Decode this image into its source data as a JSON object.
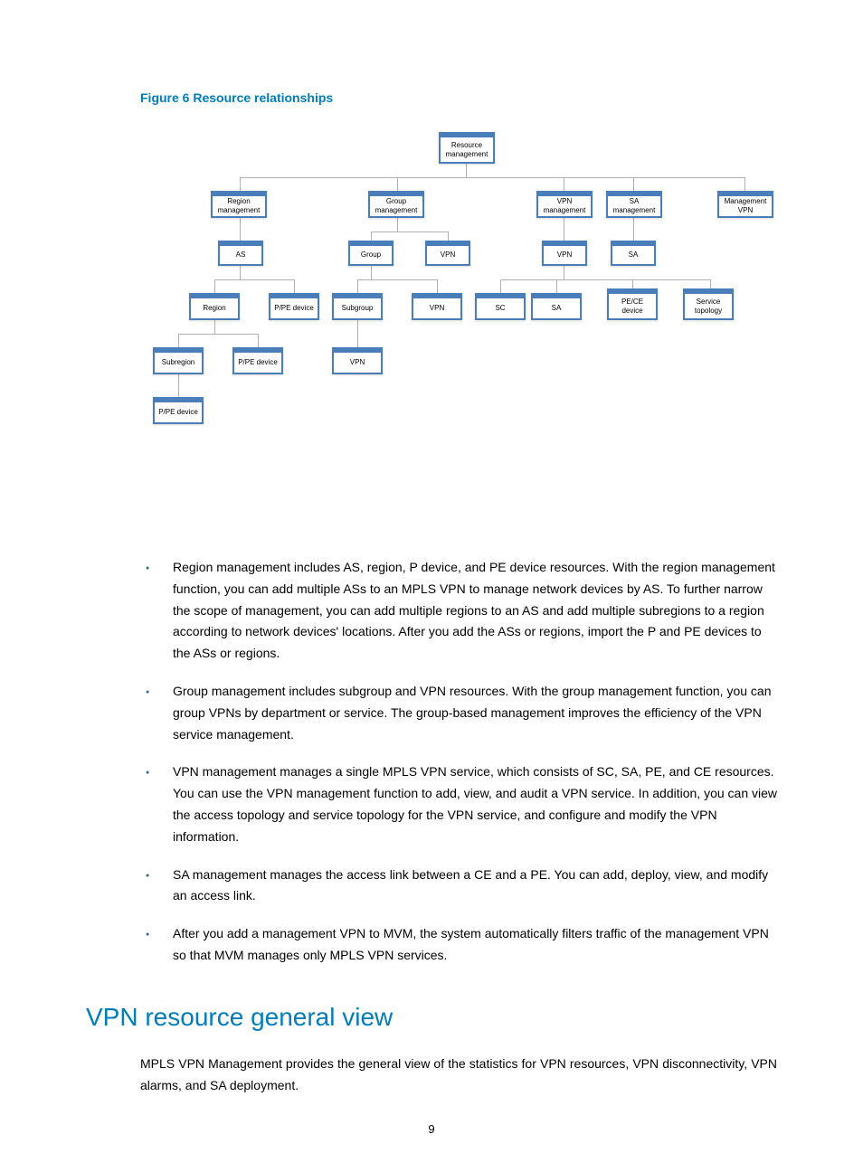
{
  "figure_caption": "Figure 6 Resource relationships",
  "diagram": {
    "root": "Resource management",
    "row1": [
      "Region management",
      "Group management",
      "VPN management",
      "SA management",
      "Management VPN"
    ],
    "row2_left": "AS",
    "row2_mid": [
      "Group",
      "VPN"
    ],
    "row2_right": [
      "VPN",
      "SA"
    ],
    "row3_left": [
      "Region",
      "P/PE device"
    ],
    "row3_mid": [
      "Subgroup",
      "VPN"
    ],
    "row3_right": [
      "SC",
      "SA",
      "PE/CE device",
      "Service topology"
    ],
    "row4_left": [
      "Subregion",
      "P/PE device"
    ],
    "row4_mid": "VPN",
    "row5": "P/PE device"
  },
  "bullets": [
    "Region management includes AS, region, P device, and PE device resources. With the region management function, you can add multiple ASs to an MPLS VPN to manage network devices by AS. To further narrow the scope of management, you can add multiple regions to an AS and add multiple subregions to a region according to network devices' locations. After you add the ASs or regions, import the P and PE devices to the ASs or regions.",
    "Group management includes subgroup and VPN resources. With the group management function, you can group VPNs by department or service. The group-based management improves the efficiency of the VPN service management.",
    "VPN management manages a single MPLS VPN service, which consists of SC, SA, PE, and CE resources. You can use the VPN management function to add, view, and audit a VPN service. In addition, you can view the access topology and service topology for the VPN service, and configure and modify the VPN information.",
    "SA management manages the access link between a CE and a PE. You can add, deploy, view, and modify an access link.",
    "After you add a management VPN to MVM, the system automatically filters traffic of the management VPN so that MVM manages only MPLS VPN services."
  ],
  "heading": "VPN resource general view",
  "paragraph": "MPLS VPN Management provides the general view of the statistics for VPN resources, VPN disconnectivity, VPN alarms, and SA deployment.",
  "page_number": "9"
}
